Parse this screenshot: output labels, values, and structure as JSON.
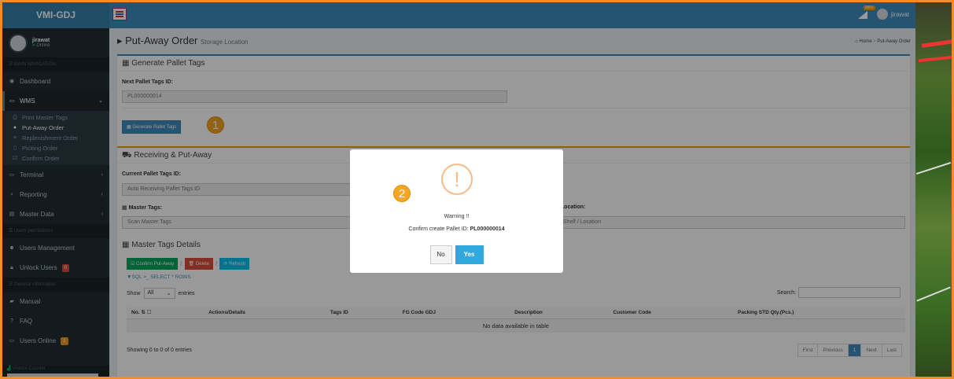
{
  "app": {
    "logo": "VMI-GDJ"
  },
  "topbar": {
    "signal_badge": "999+",
    "username": "jirawat"
  },
  "user_panel": {
    "name": "jirawat",
    "status": "Online"
  },
  "sidebar": {
    "main_nav_header": "MAIN NAVIGATION",
    "items": [
      {
        "label": "Dashboard",
        "icon": "dashboard-icon"
      },
      {
        "label": "WMS",
        "icon": "folder-icon"
      }
    ],
    "wms_sub": [
      {
        "label": "Print Master Tags",
        "icon": "print-icon"
      },
      {
        "label": "Put-Away Order",
        "icon": "map-marker-icon"
      },
      {
        "label": "Replenishment Order",
        "icon": "list-icon"
      },
      {
        "label": "Picking Order",
        "icon": "file-icon"
      },
      {
        "label": "Confirm Order",
        "icon": "check-icon"
      }
    ],
    "items2": [
      {
        "label": "Terminal",
        "icon": "folder-icon"
      },
      {
        "label": "Reporting",
        "icon": "search-icon"
      },
      {
        "label": "Master Data",
        "icon": "database-icon"
      }
    ],
    "users_header": "Users permissions",
    "users_mgmt": "Users Management",
    "unlock_users": "Unlock Users",
    "unlock_badge": "0",
    "general_header": "General information",
    "manual": "Manual",
    "faq": "FAQ",
    "users_online": "Users Online",
    "users_online_badge": "2",
    "visitors": "Visitors Counter"
  },
  "page": {
    "title": "Put-Away Order",
    "subtitle": "Storage Location",
    "breadcrumb_home": "Home",
    "breadcrumb_current": "Put-Away Order"
  },
  "generate": {
    "title": "Generate Pallet Tags",
    "next_label": "Next Pallet Tags ID:",
    "next_value": "PL000000014",
    "button": "Generate Pallet Tags",
    "step": "1"
  },
  "receiving": {
    "title": "Receiving & Put-Away",
    "current_label": "Current Pallet Tags ID:",
    "current_placeholder": "Auto Receiving Pallet Tags ID",
    "master_label": "Master Tags:",
    "master_placeholder": "Scan Master Tags",
    "location_label": "/ Location:",
    "location_placeholder": "/ Shelf / Location"
  },
  "details": {
    "title": "Master Tags Details",
    "confirm_btn": "Confirm Put-Away",
    "delete_btn": "Delete",
    "refresh_btn": "Refresh",
    "sql_text": "SQL >_ SELECT * ROWS",
    "show_label": "Show",
    "show_value": "All",
    "entries_label": "entries",
    "search_label": "Search:",
    "columns": [
      "No.",
      "Actions/Details",
      "Tags ID",
      "FG Code GDJ",
      "Description",
      "Customer Code",
      "Packing STD Qty.(Pcs.)"
    ],
    "empty": "No data available in table",
    "info": "Showing 0 to 0 of 0 entries",
    "pager": [
      "First",
      "Previous",
      "1",
      "Next",
      "Last"
    ]
  },
  "modal": {
    "icon": "!",
    "title": "Warning !!",
    "text_prefix": "Confirm create Pallet ID:",
    "text_id": "PL000000014",
    "no": "No",
    "yes": "Yes",
    "step": "2"
  }
}
